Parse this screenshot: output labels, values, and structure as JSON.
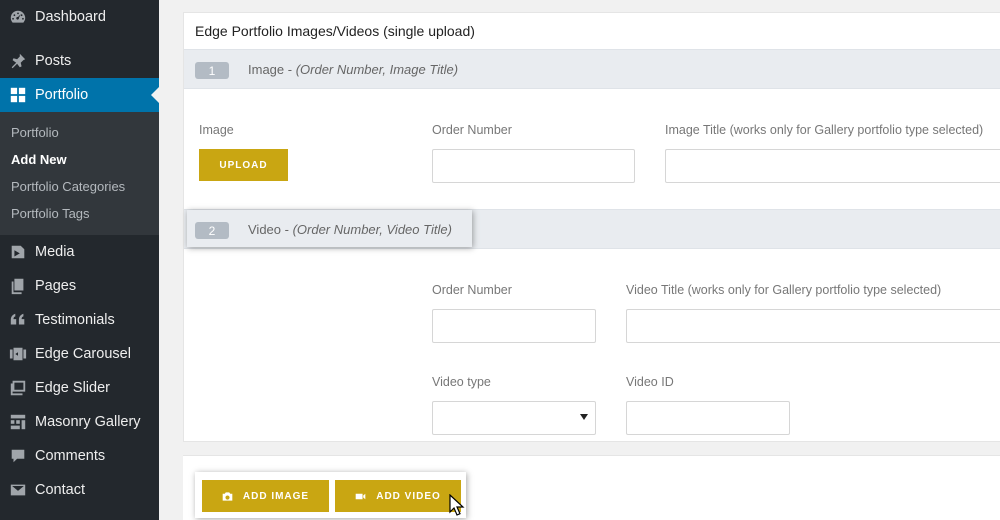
{
  "sidebar": {
    "menu": [
      {
        "label": "Dashboard",
        "icon": "dashboard-icon"
      },
      {
        "label": "Posts",
        "icon": "pin-icon"
      },
      {
        "label": "Portfolio",
        "icon": "grid-icon"
      },
      {
        "label": "Media",
        "icon": "media-icon"
      },
      {
        "label": "Pages",
        "icon": "pages-icon"
      },
      {
        "label": "Testimonials",
        "icon": "quote-icon"
      },
      {
        "label": "Edge Carousel",
        "icon": "carousel-icon"
      },
      {
        "label": "Edge Slider",
        "icon": "slider-icon"
      },
      {
        "label": "Masonry Gallery",
        "icon": "masonry-icon"
      },
      {
        "label": "Comments",
        "icon": "comment-icon"
      },
      {
        "label": "Contact",
        "icon": "mail-icon"
      }
    ],
    "submenu": [
      "Portfolio",
      "Add New",
      "Portfolio Categories",
      "Portfolio Tags"
    ]
  },
  "panel": {
    "title": "Edge Portfolio Images/Videos (single upload)",
    "image_row": {
      "number": "1",
      "label": "Image - ",
      "label_hint": "(Order Number, Image Title)",
      "image_label": "Image",
      "upload_button": "UPLOAD",
      "order_label": "Order Number",
      "order_value": "",
      "title_label": "Image Title (works only for Gallery portfolio type selected)",
      "title_value": ""
    },
    "video_row": {
      "number": "2",
      "label": "Video - ",
      "label_hint": "(Order Number, Video Title)",
      "order_label": "Order Number",
      "order_value": "",
      "title_label": "Video Title (works only for Gallery portfolio type selected)",
      "title_value": "",
      "type_label": "Video type",
      "type_value": "",
      "id_label": "Video ID",
      "id_value": ""
    }
  },
  "actions": {
    "add_image": "ADD IMAGE",
    "add_video": "ADD VIDEO"
  },
  "colors": {
    "sidebar_bg": "#23282d",
    "active_blue": "#0073aa",
    "gold_button": "#c9a612"
  }
}
